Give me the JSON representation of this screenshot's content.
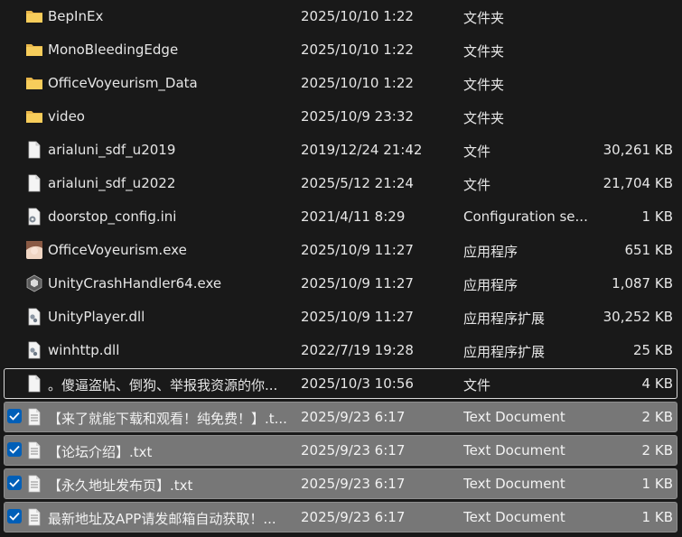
{
  "files": [
    {
      "name": "BepInEx",
      "date": "2025/10/10 1:22",
      "type": "文件夹",
      "size": "",
      "icon": "folder-icon",
      "state": "normal"
    },
    {
      "name": "MonoBleedingEdge",
      "date": "2025/10/10 1:22",
      "type": "文件夹",
      "size": "",
      "icon": "folder-icon",
      "state": "normal"
    },
    {
      "name": "OfficeVoyeurism_Data",
      "date": "2025/10/10 1:22",
      "type": "文件夹",
      "size": "",
      "icon": "folder-icon",
      "state": "normal"
    },
    {
      "name": "video",
      "date": "2025/10/9 23:32",
      "type": "文件夹",
      "size": "",
      "icon": "folder-icon",
      "state": "normal"
    },
    {
      "name": "arialuni_sdf_u2019",
      "date": "2019/12/24 21:42",
      "type": "文件",
      "size": "30,261 KB",
      "icon": "file-icon",
      "state": "normal"
    },
    {
      "name": "arialuni_sdf_u2022",
      "date": "2025/5/12 21:24",
      "type": "文件",
      "size": "21,704 KB",
      "icon": "file-icon",
      "state": "normal"
    },
    {
      "name": "doorstop_config.ini",
      "date": "2021/4/11 8:29",
      "type": "Configuration se...",
      "size": "1 KB",
      "icon": "config-file-icon",
      "state": "normal"
    },
    {
      "name": "OfficeVoyeurism.exe",
      "date": "2025/10/9 11:27",
      "type": "应用程序",
      "size": "651 KB",
      "icon": "app-avatar-icon",
      "state": "normal"
    },
    {
      "name": "UnityCrashHandler64.exe",
      "date": "2025/10/9 11:27",
      "type": "应用程序",
      "size": "1,087 KB",
      "icon": "unity-icon",
      "state": "normal"
    },
    {
      "name": "UnityPlayer.dll",
      "date": "2025/10/9 11:27",
      "type": "应用程序扩展",
      "size": "30,252 KB",
      "icon": "dll-file-icon",
      "state": "normal"
    },
    {
      "name": "winhttp.dll",
      "date": "2022/7/19 19:28",
      "type": "应用程序扩展",
      "size": "25 KB",
      "icon": "dll-file-icon",
      "state": "normal"
    },
    {
      "name": "。傻逼盗帖、倒狗、举报我资源的你...",
      "date": "2025/10/3 10:56",
      "type": "文件",
      "size": "4 KB",
      "icon": "file-icon",
      "state": "focused"
    },
    {
      "name": "【来了就能下载和观看！纯免费！】.t...",
      "date": "2025/9/23 6:17",
      "type": "Text Document",
      "size": "2 KB",
      "icon": "text-file-icon",
      "state": "selected"
    },
    {
      "name": "【论坛介绍】.txt",
      "date": "2025/9/23 6:17",
      "type": "Text Document",
      "size": "2 KB",
      "icon": "text-file-icon",
      "state": "selected"
    },
    {
      "name": "【永久地址发布页】.txt",
      "date": "2025/9/23 6:17",
      "type": "Text Document",
      "size": "1 KB",
      "icon": "text-file-icon",
      "state": "selected"
    },
    {
      "name": "最新地址及APP请发邮箱自动获取！...",
      "date": "2025/9/23 6:17",
      "type": "Text Document",
      "size": "1 KB",
      "icon": "text-file-icon",
      "state": "selected"
    }
  ],
  "colors": {
    "background": "#191919",
    "selected": "#777777",
    "checkbox": "#005fb8",
    "folder": "#f5c542"
  }
}
